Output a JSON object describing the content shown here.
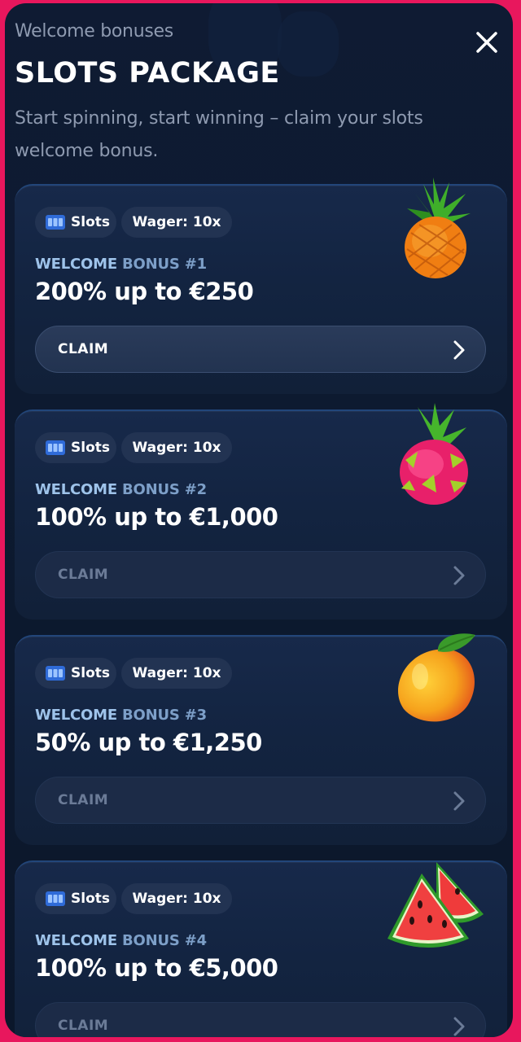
{
  "header": {
    "eyebrow": "Welcome bonuses",
    "title": "SLOTS PACKAGE",
    "subtitle": "Start spinning, start winning – claim your slots welcome bonus.",
    "close_icon": "close-icon"
  },
  "colors": {
    "frame_border": "#e8175d",
    "background": "#0f1b33",
    "card": "#14264a",
    "label_light": "#9ec3ea"
  },
  "bonuses": [
    {
      "category": "Slots",
      "wager": "Wager: 10x",
      "label_a": "WELCOME",
      "label_b": "BONUS #1",
      "amount": "200% up to €250",
      "cta": "CLAIM",
      "enabled": true,
      "fruit": "pineapple"
    },
    {
      "category": "Slots",
      "wager": "Wager: 10x",
      "label_a": "WELCOME",
      "label_b": "BONUS #2",
      "amount": "100% up to €1,000",
      "cta": "CLAIM",
      "enabled": false,
      "fruit": "dragon-fruit"
    },
    {
      "category": "Slots",
      "wager": "Wager: 10x",
      "label_a": "WELCOME",
      "label_b": "BONUS #3",
      "amount": "50% up to €1,250",
      "cta": "CLAIM",
      "enabled": false,
      "fruit": "mango"
    },
    {
      "category": "Slots",
      "wager": "Wager: 10x",
      "label_a": "WELCOME",
      "label_b": "BONUS #4",
      "amount": "100% up to €5,000",
      "cta": "CLAIM",
      "enabled": false,
      "fruit": "watermelon"
    }
  ]
}
